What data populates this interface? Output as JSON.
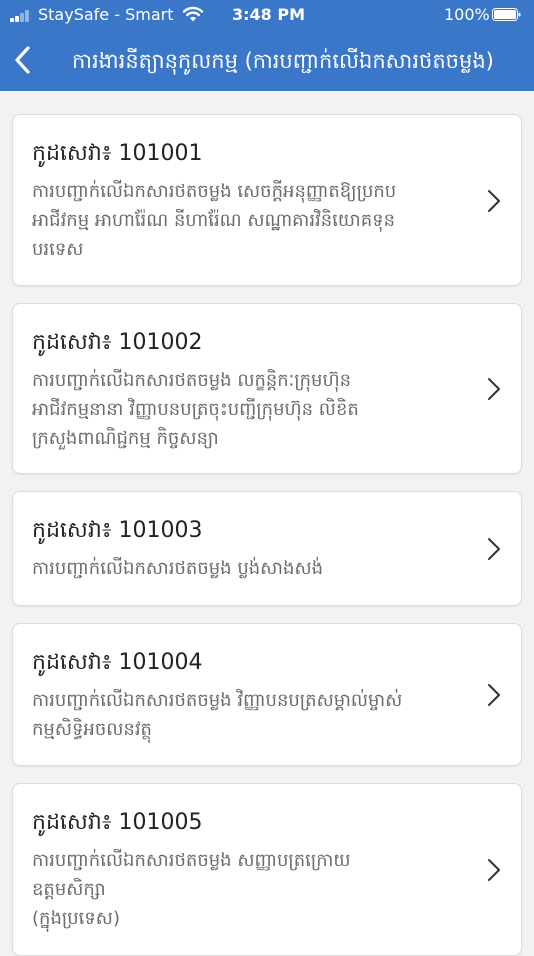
{
  "status_bar": {
    "carrier": "StaySafe - Smart",
    "time": "3:48 PM",
    "battery": "100%",
    "battery_level": 1.0,
    "signal_icon": "cellular-signal-icon",
    "wifi_icon": "wifi-icon",
    "battery_icon": "battery-icon"
  },
  "nav": {
    "back_icon": "chevron-left-icon",
    "title": "ការងារនីត្យានុកូលកម្ម (ការបញ្ជាក់លើឯកសារថតចម្លង)"
  },
  "services": [
    {
      "code": "កូដសេវា៖ 101001",
      "desc_lines": [
        "ការបញ្ជាក់លើឯកសារថតចម្លង សេចក្តីអនុញ្ញាតឱ្យប្រកប",
        "អាជីវកម្ម អាហារ៉ែណ នីហារ៉ែណ សណ្ឋាគារវិនិយោគទុន",
        "បរទេស"
      ]
    },
    {
      "code": "កូដសេវា៖ 101002",
      "desc_lines": [
        "ការបញ្ជាក់លើឯកសារថតចម្លង លក្ខន្តិកៈក្រុមហ៊ុន",
        "អាជីវកម្មនានា វិញ្ញាបនបត្រចុះបញ្ជីក្រុមហ៊ុន លិខិត",
        "ក្រសួងពាណិជ្ជកម្ម កិច្ចសន្យា"
      ]
    },
    {
      "code": "កូដសេវា៖ 101003",
      "desc_lines": [
        "ការបញ្ជាក់លើឯកសារថតចម្លង ប្លង់សាងសង់"
      ]
    },
    {
      "code": "កូដសេវា៖ 101004",
      "desc_lines": [
        "ការបញ្ជាក់លើឯកសារថតចម្លង វិញ្ញាបនបត្រសម្គាល់ម្ចាស់",
        "កម្មសិទ្ធិអចលនវត្ថុ"
      ]
    },
    {
      "code": "កូដសេវា៖ 101005",
      "desc_lines": [
        "ការបញ្ជាក់លើឯកសារថតចម្លង សញ្ញាបត្រក្រោយ",
        "ឧត្តមសិក្សា",
        "(ក្នុងប្រទេស)"
      ]
    }
  ],
  "colors": {
    "header_bg": "#3a77c8",
    "page_bg": "#f2f2f2",
    "card_bg": "#ffffff",
    "code_text": "#222222",
    "desc_text": "#6b6b6b"
  },
  "chevron_icon": "chevron-right-icon"
}
